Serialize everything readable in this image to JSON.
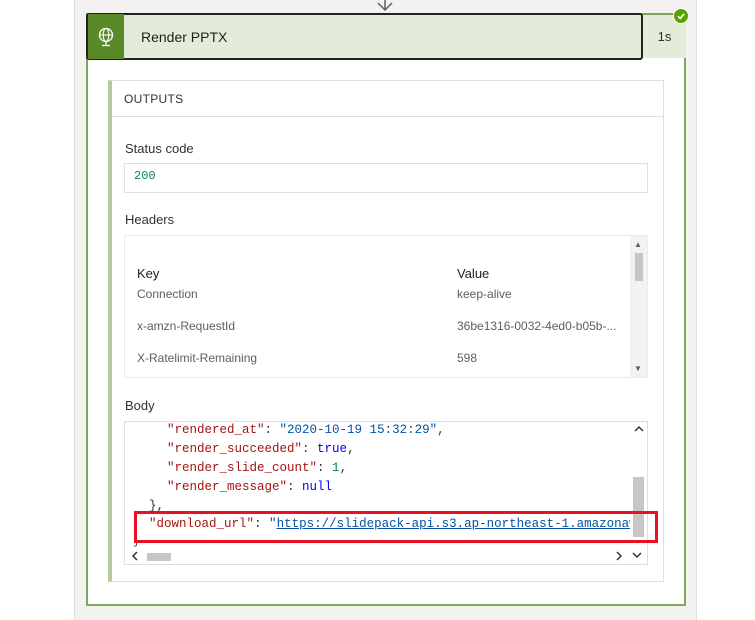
{
  "action": {
    "title": "Render PPTX",
    "duration": "1s",
    "status_color": "#57a300",
    "icon": "globe-icon",
    "check_icon": "checkmark-icon"
  },
  "outputs": {
    "section_title": "OUTPUTS",
    "status_code_label": "Status code",
    "status_code_value": "200",
    "headers_label": "Headers",
    "headers_table": {
      "columns": [
        "Key",
        "Value"
      ],
      "rows": [
        {
          "key": "Connection",
          "value": "keep-alive"
        },
        {
          "key": "x-amzn-RequestId",
          "value": "36be1316-0032-4ed0-b05b-..."
        },
        {
          "key": "X-Ratelimit-Remaining",
          "value": "598"
        }
      ]
    },
    "body_label": "Body",
    "body_lines": [
      {
        "key": "\"rendered_at\"",
        "sep": ": ",
        "value": "\"2020-10-19 15:32:29\"",
        "tail": ","
      },
      {
        "key": "\"render_succeeded\"",
        "sep": ": ",
        "value": "true",
        "tail": ","
      },
      {
        "key": "\"render_slide_count\"",
        "sep": ": ",
        "value": "1",
        "tail": ","
      },
      {
        "key": "\"render_message\"",
        "sep": ": ",
        "value": "null",
        "tail": ""
      },
      {
        "text": "},"
      },
      {
        "key": "\"download_url\"",
        "sep": ": ",
        "quote": "\"",
        "value": "https://slidepack-api.s3.ap-northeast-1.amazonaw"
      },
      {
        "text": "}"
      }
    ]
  }
}
